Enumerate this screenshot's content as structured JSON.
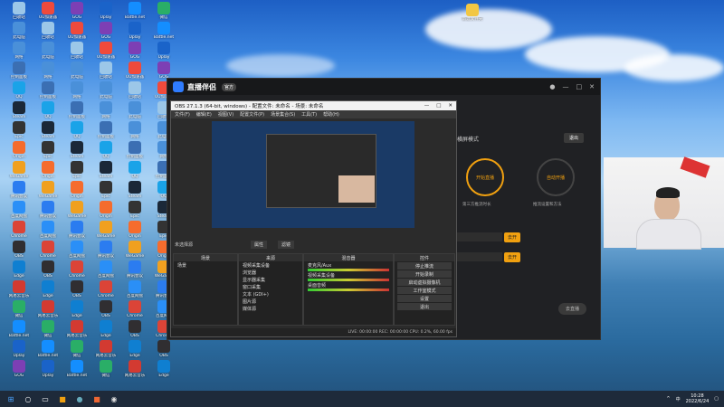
{
  "desktop": {
    "icons": [
      {
        "label": "回收站",
        "color": "#9cc7e8"
      },
      {
        "label": "此电脑",
        "color": "#4a90d9"
      },
      {
        "label": "网络",
        "color": "#4a90d9"
      },
      {
        "label": "控制面板",
        "color": "#3b6fb3"
      },
      {
        "label": "QQ",
        "color": "#1aa3e8"
      },
      {
        "label": "Steam",
        "color": "#1b2838"
      },
      {
        "label": "Epic",
        "color": "#333"
      },
      {
        "label": "Origin",
        "color": "#f56c2d"
      },
      {
        "label": "WeGame",
        "color": "#f0a020"
      },
      {
        "label": "腾讯会议",
        "color": "#2b7cf0"
      },
      {
        "label": "百度网盘",
        "color": "#2a8ff7"
      },
      {
        "label": "Chrome",
        "color": "#db4437"
      },
      {
        "label": "OBS",
        "color": "#302e31"
      },
      {
        "label": "Edge",
        "color": "#0f7fd1"
      },
      {
        "label": "网易云音乐",
        "color": "#d33a31"
      },
      {
        "label": "微信",
        "color": "#2aae67"
      },
      {
        "label": "Battle.net",
        "color": "#148eff"
      },
      {
        "label": "Uplay",
        "color": "#1a63c9"
      },
      {
        "label": "GOG",
        "color": "#7d3fb4"
      },
      {
        "label": "UU加速器",
        "color": "#ef4a3c"
      }
    ],
    "folder": "新建文件夹"
  },
  "zhibo": {
    "title": "直播伴侣",
    "badge": "官方",
    "mode_label": "横屏模式",
    "tag_button": "退出",
    "circle1": "开始直播",
    "circle2": "自动开播",
    "go_button": "去开",
    "caption1": "第三方推流时长",
    "caption2": "推流设置和方法",
    "start_button": "去直播"
  },
  "obs": {
    "title": "OBS 27.1.3 (64-bit, windows) - 配置文件: 未命名 - 场景: 未命名",
    "menu": [
      "文件(F)",
      "编辑(E)",
      "视图(V)",
      "配置文件(P)",
      "场景集合(S)",
      "工具(T)",
      "帮助(H)"
    ],
    "no_source": "未选择源",
    "props_button": "属性",
    "filters_button": "滤镜",
    "panels": {
      "scenes": "场景",
      "sources": "来源",
      "mixer": "混音器",
      "transitions": "转场特效",
      "controls": "控件"
    },
    "scene_item": "场景",
    "sources": [
      "视频采集设备",
      "浏览器",
      "显示器采集",
      "窗口采集",
      "文本 (GDI+)",
      "图片源",
      "媒体源"
    ],
    "mixer_tracks": [
      {
        "name": "麦克风/Aux",
        "db": "0.0 dB"
      },
      {
        "name": "视频采集设备",
        "db": "0.0 dB"
      },
      {
        "name": "桌面音频",
        "db": "0.0 dB"
      }
    ],
    "controls": [
      "停止推流",
      "开始录制",
      "启动虚拟摄像机",
      "工作室模式",
      "设置",
      "退出"
    ],
    "transition_tab": "转场特效",
    "status": "LIVE: 00:00:00   REC: 00:00:00   CPU: 0.2%, 60.00 fps"
  },
  "taskbar": {
    "time": "10:28",
    "date": "2022/6/24",
    "lang": "中"
  }
}
